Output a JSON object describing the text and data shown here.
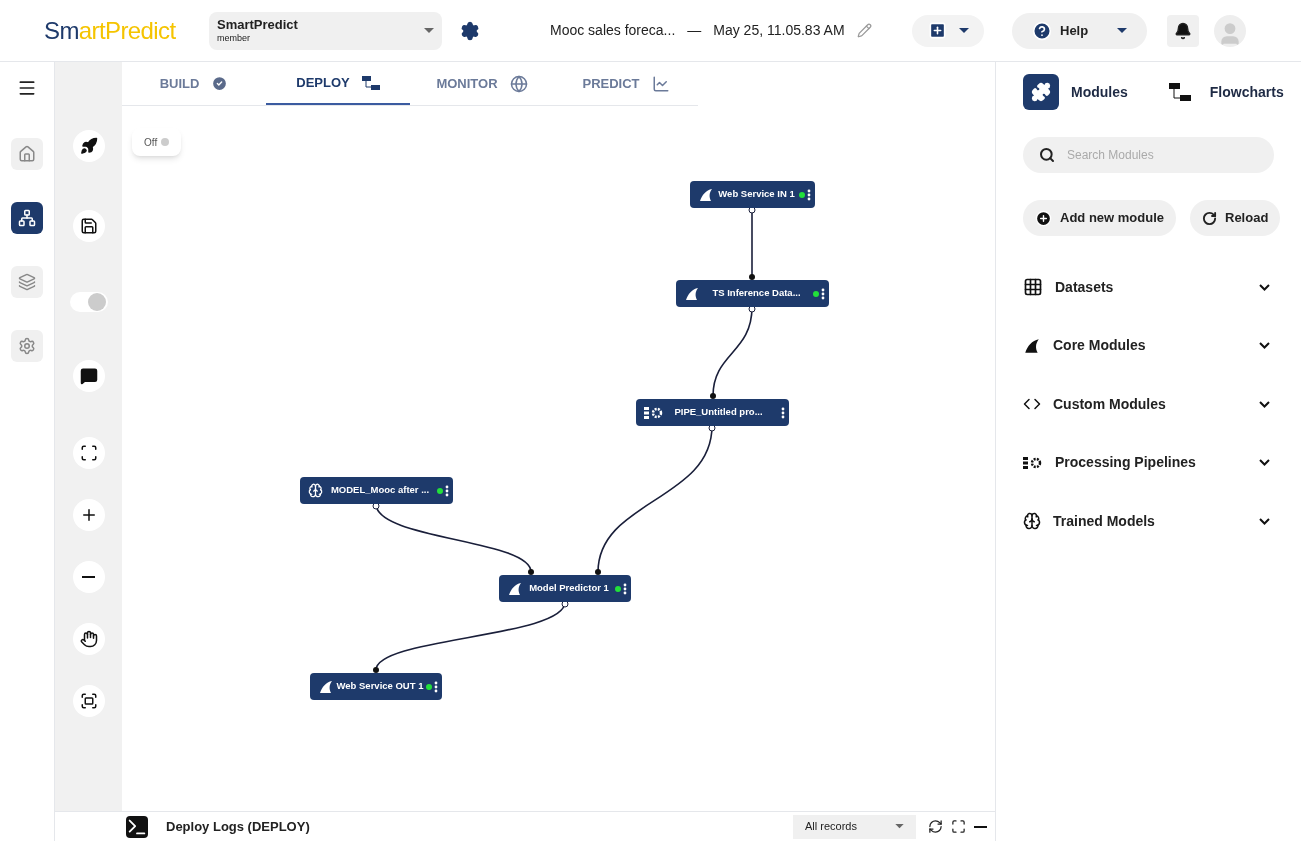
{
  "header": {
    "logo": {
      "dark": "Sm",
      "light": "rtPredict",
      "accent": "a"
    },
    "workspace": {
      "name": "SmartPredict",
      "role": "member"
    },
    "project": {
      "title": "Mooc sales foreca...",
      "separator": "—",
      "date": "May 25, 11.05.83 AM"
    },
    "help": "Help"
  },
  "rail": [
    {
      "kind": "home",
      "selected": false
    },
    {
      "kind": "flow",
      "selected": true
    },
    {
      "kind": "layers",
      "selected": false
    },
    {
      "kind": "settings",
      "selected": false
    }
  ],
  "tabs": [
    {
      "label": "BUILD",
      "kind": "check",
      "selected": false
    },
    {
      "label": "DEPLOY",
      "kind": "flow",
      "selected": true
    },
    {
      "label": "MONITOR",
      "kind": "globe",
      "selected": false
    },
    {
      "label": "PREDICT",
      "kind": "chart",
      "selected": false
    }
  ],
  "tools": [
    {
      "kind": "rocket"
    },
    {
      "kind": "save"
    },
    {
      "kind": "toggle",
      "on": true
    },
    {
      "kind": "preview"
    },
    {
      "kind": "fit"
    },
    {
      "kind": "zoom-in"
    },
    {
      "kind": "zoom-out"
    },
    {
      "kind": "pan"
    },
    {
      "kind": "frame"
    }
  ],
  "canvas_switch": {
    "label": "Off",
    "on": false
  },
  "nodes": [
    {
      "label": "Web Service IN 1",
      "kind": "core",
      "active": true
    },
    {
      "label": "TS Inference Data...",
      "kind": "core",
      "active": true
    },
    {
      "label": "PIPE_Untitled pro...",
      "kind": "pipeline",
      "active": false
    },
    {
      "label": "MODEL_Mooc after ...",
      "kind": "model",
      "active": true
    },
    {
      "label": "Model Predictor 1",
      "kind": "core",
      "active": true
    },
    {
      "label": "Web Service OUT 1",
      "kind": "core",
      "active": true
    }
  ],
  "logs": {
    "title": "Deploy Logs (DEPLOY)",
    "filter": "All records"
  },
  "panel": {
    "tabs": [
      {
        "label": "Modules",
        "kind": "puzzle",
        "selected": true
      },
      {
        "label": "Flowcharts",
        "kind": "flow",
        "selected": false
      }
    ],
    "search": {
      "placeholder": "Search Modules"
    },
    "buttons": [
      {
        "label": "Add new module",
        "kind": "add"
      },
      {
        "label": "Reload",
        "kind": "reload"
      }
    ],
    "sections": [
      {
        "label": "Datasets",
        "kind": "grid",
        "expanded": false
      },
      {
        "label": "Core Modules",
        "kind": "core",
        "expanded": false
      },
      {
        "label": "Custom Modules",
        "kind": "python",
        "expanded": false
      },
      {
        "label": "Processing Pipelines",
        "kind": "pipeline",
        "expanded": false
      },
      {
        "label": "Trained Models",
        "kind": "model",
        "expanded": false
      }
    ]
  }
}
